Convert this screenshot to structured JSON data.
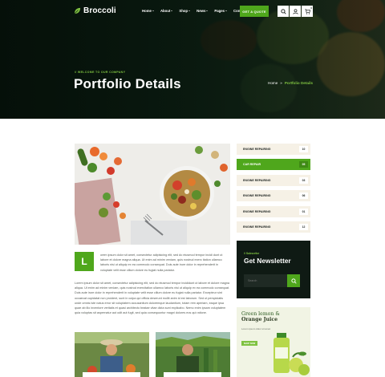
{
  "brand": {
    "name": "Broccoli"
  },
  "nav": {
    "items": [
      {
        "label": "Home",
        "dropdown": true
      },
      {
        "label": "About",
        "dropdown": true
      },
      {
        "label": "Shop",
        "dropdown": true
      },
      {
        "label": "News",
        "dropdown": true
      },
      {
        "label": "Pages",
        "dropdown": true
      },
      {
        "label": "Contact",
        "dropdown": false
      }
    ],
    "cta_label": "GET A QUOTE",
    "cart_count": "0"
  },
  "hero": {
    "welcome": "// WELCOME TO OUR COMPANY",
    "title": "Portfolio Details",
    "breadcrumb": {
      "home": "Home",
      "separator": "»",
      "current": "Portfolio Details"
    }
  },
  "content": {
    "dropcap": "L",
    "lead": "orem ipsum dolor sit amet, consectetur adipisicing elit, sed do eiusmod tempor incidi dunt ut labore et dolore magna aliqua. Ut enim ad minim veniam, quis nostrud exerc itation ullamco laboris nisi ut aliquip ex ea commodo consequat. Duis aute irure dolor in reprehenderit in voluptate velit esse cillum dolore eu fugiat nulla pariatur.",
    "body": "Lorem ipsum dolor sit amet, consectetur adipisicing elit, sed do eiusmod tempor incididunt ut labore et dolore magna aliqua. Ut enim ad minim veniam, quis nostrud exercitation ullamco laboris nisi ut aliquip ex ea commodo consequat. Duis aute irure dolor in reprehenderit in voluptate velit esse cillum dolore eu fugiat nulla pariatur. Excepteur sint occaecat cupidatat non proident, sunt in culpa qui officia deserunt mollit anim id est laborum. Sed ut perspiciatis unde omnis iste natus error sit voluptatem accusantium doloremque laudantium, totam rem aperiam, eaque ipsa quae ab illo inventore veritatis et quasi architecto beatae vitae dicta sunt explicabo. Nemo enim ipsam voluptatem quia voluptas sit aspernatur aut odit aut fugit, sed quia consequuntur magni dolores eos qui ratione."
  },
  "services": [
    {
      "label": "ENGINE REPAIRING",
      "number": "10",
      "active": false
    },
    {
      "label": "CAR REPAIR",
      "number": "05",
      "active": true
    },
    {
      "label": "ENGINE REPAIRING",
      "number": "03",
      "active": false
    },
    {
      "label": "ENGINE REPAIRING",
      "number": "06",
      "active": false
    },
    {
      "label": "ENGINE REPAIRING",
      "number": "01",
      "active": false
    },
    {
      "label": "ENGINE REPAIRING",
      "number": "12",
      "active": false
    }
  ],
  "newsletter": {
    "subtitle": "// Subscribe",
    "title": "Get Newsletter",
    "placeholder": "Search"
  },
  "promo": {
    "line1": "Green lemon &",
    "line2": "Orange Juice",
    "subtitle": "Lorem ipsum dolor sit amet",
    "button": "SHOP NOW"
  },
  "colors": {
    "accent": "#4fa71c",
    "accent_light": "#7fc241",
    "dark": "#0f1a14",
    "service_bg": "#f6f1e6"
  },
  "icons": [
    "leaf-icon",
    "search-icon",
    "user-icon",
    "cart-icon",
    "send-icon"
  ]
}
